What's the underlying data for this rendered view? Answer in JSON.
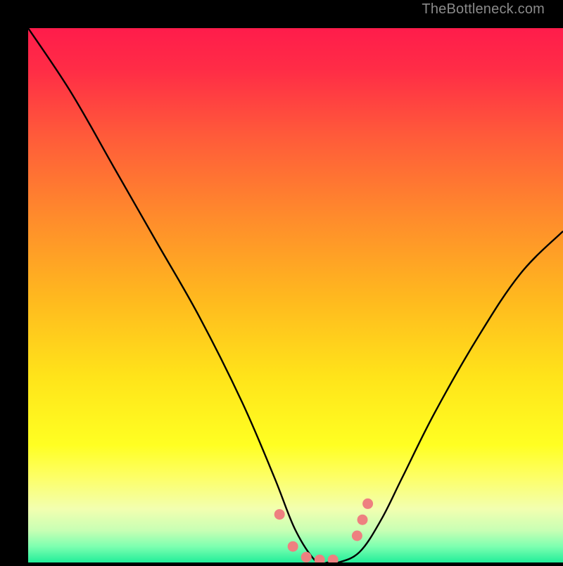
{
  "watermark": "TheBottleneck.com",
  "chart_data": {
    "type": "line",
    "title": "",
    "xlabel": "",
    "ylabel": "",
    "xlim": [
      0,
      100
    ],
    "ylim": [
      0,
      100
    ],
    "grid": false,
    "series": [
      {
        "name": "curve",
        "x": [
          0,
          8,
          16,
          24,
          32,
          40,
          46,
          50,
          54,
          56,
          58,
          62,
          66,
          70,
          76,
          84,
          92,
          100
        ],
        "y": [
          100,
          88,
          74,
          60,
          46,
          30,
          16,
          6,
          0,
          0,
          0,
          2,
          8,
          16,
          28,
          42,
          54,
          62
        ]
      }
    ],
    "markers": {
      "name": "highlighted-points",
      "x": [
        47,
        49.5,
        52,
        54.5,
        57,
        61.5,
        62.5,
        63.5
      ],
      "y": [
        9,
        3,
        1,
        0.5,
        0.5,
        5,
        8,
        11
      ]
    },
    "background_gradient": {
      "stops": [
        {
          "offset": 0.0,
          "color": "#ff1c4b"
        },
        {
          "offset": 0.08,
          "color": "#ff2d46"
        },
        {
          "offset": 0.2,
          "color": "#ff5a3a"
        },
        {
          "offset": 0.35,
          "color": "#ff8a2c"
        },
        {
          "offset": 0.5,
          "color": "#ffb71f"
        },
        {
          "offset": 0.65,
          "color": "#ffe31a"
        },
        {
          "offset": 0.78,
          "color": "#ffff22"
        },
        {
          "offset": 0.84,
          "color": "#fdff66"
        },
        {
          "offset": 0.9,
          "color": "#f2ffb0"
        },
        {
          "offset": 0.94,
          "color": "#c8ffb4"
        },
        {
          "offset": 0.97,
          "color": "#7dffb0"
        },
        {
          "offset": 1.0,
          "color": "#22ee9a"
        }
      ]
    },
    "curve_color": "#000000",
    "marker_color": "#ee8080"
  }
}
